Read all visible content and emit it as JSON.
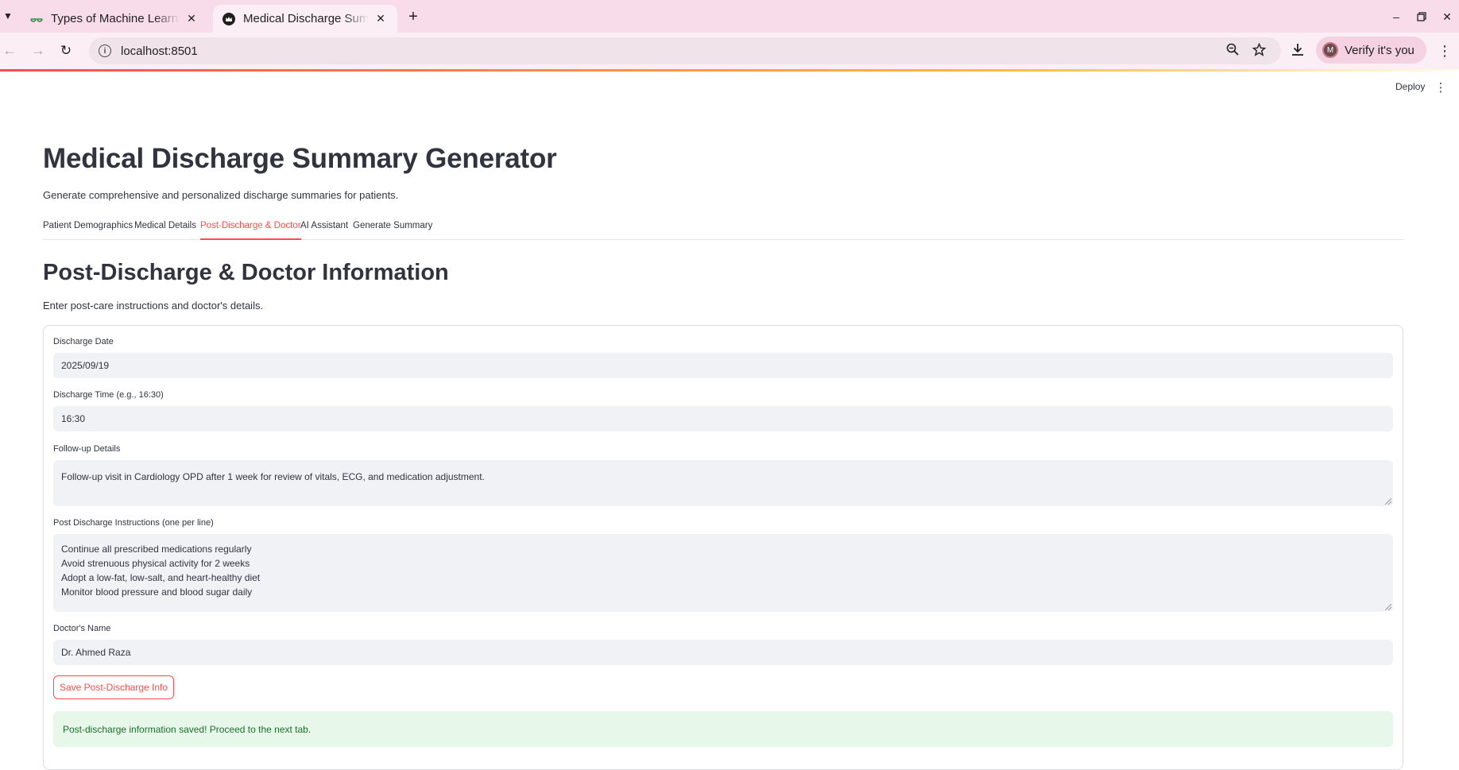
{
  "browser": {
    "tabs": [
      {
        "title": "Types of Machine Learning",
        "icon": "geeksforgeeks-icon"
      },
      {
        "title": "Medical Discharge Summary Generator",
        "icon": "streamlit-crown-icon"
      }
    ],
    "url": "localhost:8501",
    "profile_label": "Verify it's you",
    "profile_initial": "M"
  },
  "app_header": {
    "deploy_label": "Deploy"
  },
  "page": {
    "title": "Medical Discharge Summary Generator",
    "subtitle": "Generate comprehensive and personalized discharge summaries for patients.",
    "tabs": [
      {
        "label": "Patient Demographics"
      },
      {
        "label": "Medical Details"
      },
      {
        "label": "Post-Discharge & Doctor",
        "active": true
      },
      {
        "label": "AI Assistant"
      },
      {
        "label": "Generate Summary"
      }
    ],
    "section_title": "Post-Discharge & Doctor Information",
    "section_desc": "Enter post-care instructions and doctor's details."
  },
  "form": {
    "discharge_date": {
      "label": "Discharge Date",
      "value": "2025/09/19"
    },
    "discharge_time": {
      "label": "Discharge Time (e.g., 16:30)",
      "value": "16:30"
    },
    "follow_up": {
      "label": "Follow-up Details",
      "value": "Follow-up visit in Cardiology OPD after 1 week for review of vitals, ECG, and medication adjustment."
    },
    "instructions": {
      "label": "Post Discharge Instructions (one per line)",
      "lines": [
        "Continue all prescribed medications regularly",
        "Avoid strenuous physical activity for 2 weeks",
        "Adopt a low-fat, low-salt, and heart-healthy diet",
        "Monitor blood pressure and blood sugar daily"
      ]
    },
    "doctor_name": {
      "label": "Doctor's Name",
      "value": "Dr. Ahmed Raza"
    },
    "save_button": "Save Post-Discharge Info",
    "success_message": "Post-discharge information saved! Proceed to the next tab."
  },
  "colors": {
    "accent": "#ff4b4b",
    "success_bg": "#e7f7ea",
    "success_text": "#1c6e2e",
    "input_bg": "#f0f2f6"
  }
}
